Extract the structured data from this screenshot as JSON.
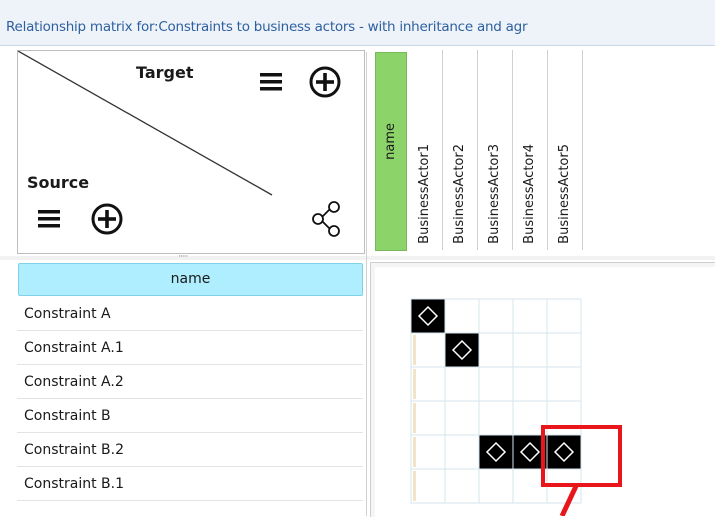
{
  "header": {
    "title": "Relationship matrix for:Constraints to business actors - with inheritance and agr"
  },
  "corner": {
    "target_label": "Target",
    "source_label": "Source",
    "icons": [
      "menu-icon",
      "add-circle-icon",
      "share-icon"
    ]
  },
  "columns": {
    "name_label": "name",
    "items": [
      "BusinessActor1",
      "BusinessActor2",
      "BusinessActor3",
      "BusinessActor4",
      "BusinessActor5"
    ]
  },
  "rows": {
    "header_label": "name",
    "items": [
      "Constraint A",
      "Constraint A.1",
      "Constraint A.2",
      "Constraint B",
      "Constraint B.2",
      "Constraint B.1"
    ]
  },
  "matrix": {
    "relations": [
      [
        0,
        0
      ],
      [
        1,
        1
      ],
      [
        4,
        2
      ],
      [
        4,
        3
      ],
      [
        4,
        4
      ]
    ],
    "highlighted_cell": [
      4,
      4
    ],
    "colors": {
      "filled_cell": "#000000",
      "name_column": "#8cd46a",
      "row_name_header": "#aeeeff",
      "highlight": "#e8161b",
      "title_text": "#2e5f9e"
    }
  }
}
